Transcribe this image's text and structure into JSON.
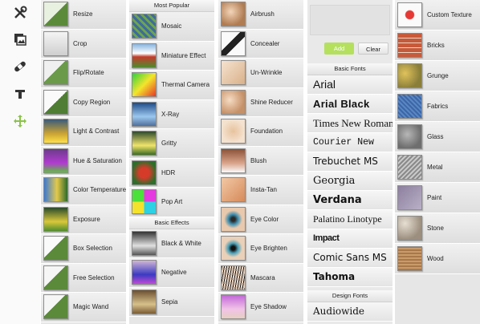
{
  "toolbar": {
    "icons": [
      "tools-icon",
      "photo-icon",
      "band-aid-icon",
      "text-icon",
      "move-icon"
    ]
  },
  "columns": [
    {
      "items": [
        {
          "label": "Resize"
        },
        {
          "label": "Crop"
        },
        {
          "label": "Flip/Rotate"
        },
        {
          "label": "Copy Region"
        },
        {
          "label": "Light & Contrast"
        },
        {
          "label": "Hue & Saturation"
        },
        {
          "label": "Color Temperature"
        },
        {
          "label": "Exposure"
        },
        {
          "label": "Box Selection"
        },
        {
          "label": "Free Selection"
        },
        {
          "label": "Magic Wand"
        }
      ]
    },
    {
      "header": "Most Popular",
      "items": [
        {
          "label": "Mosaic"
        },
        {
          "label": "Miniature Effect"
        },
        {
          "label": "Thermal Camera"
        },
        {
          "label": "X-Ray"
        },
        {
          "label": "Gritty"
        },
        {
          "label": "HDR"
        },
        {
          "label": "Pop Art"
        }
      ],
      "header2": "Basic Effects",
      "items2": [
        {
          "label": "Black & White"
        },
        {
          "label": "Negative"
        },
        {
          "label": "Sepia"
        }
      ]
    },
    {
      "items": [
        {
          "label": "Airbrush"
        },
        {
          "label": "Concealer"
        },
        {
          "label": "Un-Wrinkle"
        },
        {
          "label": "Shine Reducer"
        },
        {
          "label": "Foundation"
        },
        {
          "label": "Blush"
        },
        {
          "label": "Insta-Tan"
        },
        {
          "label": "Eye Color"
        },
        {
          "label": "Eye Brighten"
        },
        {
          "label": "Mascara"
        },
        {
          "label": "Eye Shadow"
        }
      ]
    },
    {
      "add_label": "Add",
      "clear_label": "Clear",
      "header": "Basic Fonts",
      "fonts": [
        "Arial",
        "Arial Black",
        "Times New Roman",
        "Courier New",
        "Trebuchet MS",
        "Georgia",
        "Verdana",
        "Palatino Linotype",
        "Impact",
        "Comic Sans MS",
        "Tahoma"
      ],
      "header2": "Design Fonts",
      "design_fonts": [
        "Audiowide"
      ]
    },
    {
      "items": [
        {
          "label": "Custom Texture"
        },
        {
          "label": "Bricks"
        },
        {
          "label": "Grunge"
        },
        {
          "label": "Fabrics"
        },
        {
          "label": "Glass"
        },
        {
          "label": "Metal"
        },
        {
          "label": "Paint"
        },
        {
          "label": "Stone"
        },
        {
          "label": "Wood"
        }
      ]
    }
  ]
}
